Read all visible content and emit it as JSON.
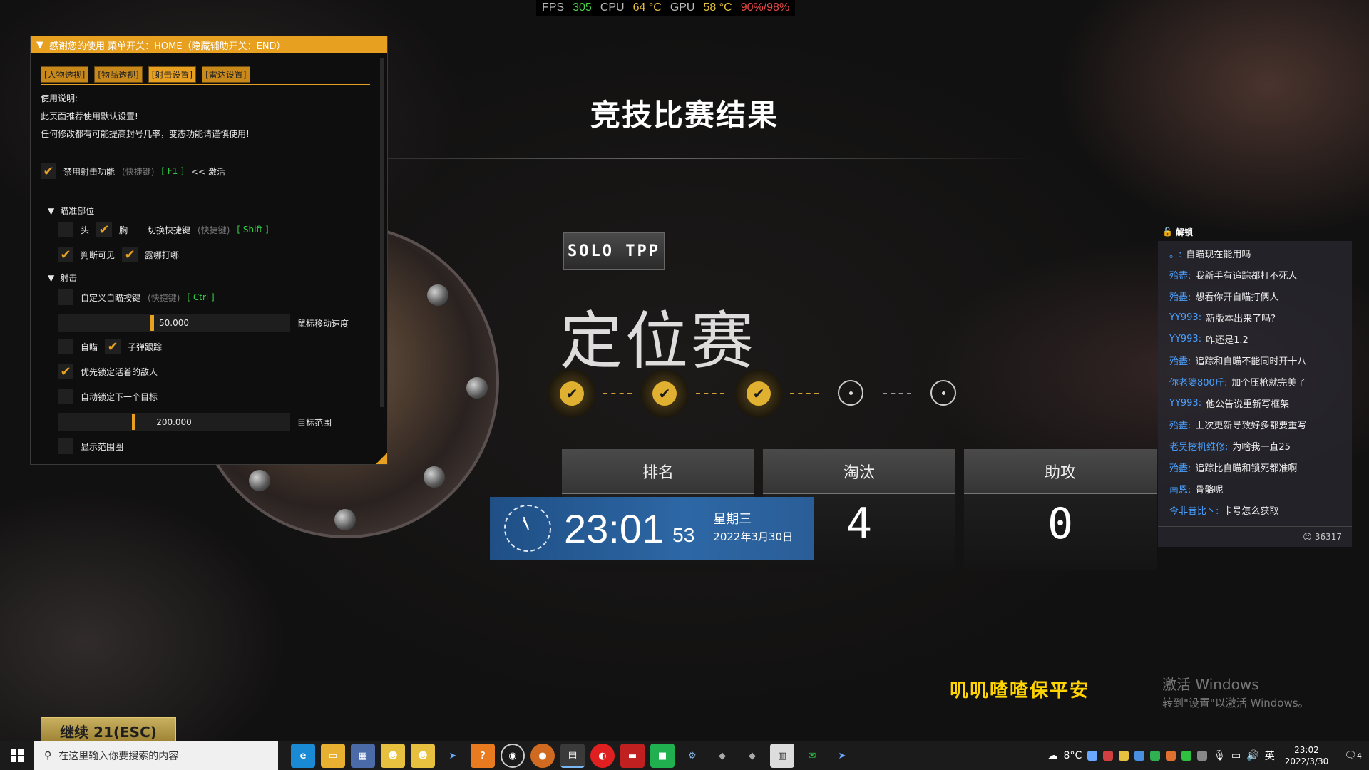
{
  "perf": {
    "fps_label": "FPS",
    "fps": "305",
    "cpu_label": "CPU",
    "cpu_temp": "64 °C",
    "gpu_label": "GPU",
    "gpu_temp": "58 °C",
    "usage": "90%/98%"
  },
  "result": {
    "title": "竞技比赛结果",
    "mode_badge": "SOLO TPP",
    "mode_name": "定位赛",
    "progress": {
      "completed": 3,
      "total": 5
    },
    "stats": [
      {
        "label": "排名",
        "value": ""
      },
      {
        "label": "淘汰",
        "value": "4"
      },
      {
        "label": "助攻",
        "value": "0"
      }
    ]
  },
  "clock": {
    "time": "23:01",
    "seconds": "53",
    "weekday": "星期三",
    "date": "2022年3月30日"
  },
  "panel": {
    "header": "感谢您的使用 菜单开关：HOME（隐藏辅助开关：END）",
    "tabs": [
      "[人物透视]",
      "[物品透视]",
      "[射击设置]",
      "[雷达设置]"
    ],
    "intro": [
      "使用说明:",
      "此页面推荐使用默认设置!",
      "任何修改都有可能提高封号几率，变态功能请谨慎使用!"
    ],
    "disable_shoot": {
      "label": "禁用射击功能",
      "hint": "(快捷键)",
      "key": "[ F1 ]",
      "suffix": "<< 激活",
      "checked": true
    },
    "aim_section": "瞄准部位",
    "head": {
      "label": "头",
      "checked": false
    },
    "chest": {
      "label": "胸",
      "checked": true
    },
    "switch_key": {
      "label": "切换快捷键",
      "hint": "(快捷键)",
      "key": "[ Shift ]"
    },
    "visible_check": {
      "label": "判断可见",
      "checked": true
    },
    "exposed_hit": {
      "label": "露哪打哪",
      "checked": true
    },
    "shoot_section": "射击",
    "custom_aim": {
      "label": "自定义自瞄按键",
      "hint": "(快捷键)",
      "key": "[ Ctrl ]",
      "checked": false
    },
    "mouse_speed": {
      "value": "50.000",
      "label": "鼠标移动速度",
      "fraction": 0.4
    },
    "auto_aim": {
      "label": "自瞄",
      "checked": false
    },
    "bullet_track": {
      "label": "子弹跟踪",
      "checked": true
    },
    "lock_alive": {
      "label": "优先锁定活着的敌人",
      "checked": true
    },
    "auto_next": {
      "label": "自动锁定下一个目标",
      "checked": false
    },
    "target_range": {
      "value": "200.000",
      "label": "目标范围",
      "fraction": 0.32
    },
    "show_range": {
      "label": "显示范围圈",
      "checked": false
    },
    "check_glyph": "✔"
  },
  "chat": {
    "header": "解锁",
    "messages": [
      {
        "user": "。:",
        "text": "自瞄现在能用吗"
      },
      {
        "user": "殆盡:",
        "text": "我新手有追踪都打不死人"
      },
      {
        "user": "殆盡:",
        "text": "想看你开自瞄打俩人"
      },
      {
        "user": "YY993:",
        "text": "新版本出来了吗?"
      },
      {
        "user": "YY993:",
        "text": "咋还是1.2"
      },
      {
        "user": "殆盡:",
        "text": "追踪和自瞄不能同时开十八"
      },
      {
        "user": "你老婆800斤:",
        "text": "加个压枪就完美了"
      },
      {
        "user": "YY993:",
        "text": "他公告说重新写框架"
      },
      {
        "user": "殆盡:",
        "text": "上次更新导致好多都要重写"
      },
      {
        "user": "老吴挖机维修:",
        "text": "为啥我一直25"
      },
      {
        "user": "殆盡:",
        "text": "追踪比自瞄和锁死都准啊"
      },
      {
        "user": "南恩:",
        "text": "骨骼呢"
      },
      {
        "user": "今非昔比丶:",
        "text": "卡号怎么获取"
      }
    ],
    "viewers": "36317"
  },
  "slogan": "叽叽喳喳保平安",
  "activate": {
    "line1": "激活 Windows",
    "line2": "转到\"设置\"以激活 Windows。"
  },
  "continue_label": "继续 21(ESC)",
  "taskbar": {
    "search_placeholder": "在这里输入你要搜索的内容",
    "weather": "8°C",
    "ime": "英",
    "time": "23:02",
    "date": "2022/3/30",
    "notif_count": "4"
  },
  "colors": {
    "accent": "#e8a020",
    "check": "#e0b030",
    "slogan": "#ffd400",
    "chat_user": "#4aa0ff"
  }
}
